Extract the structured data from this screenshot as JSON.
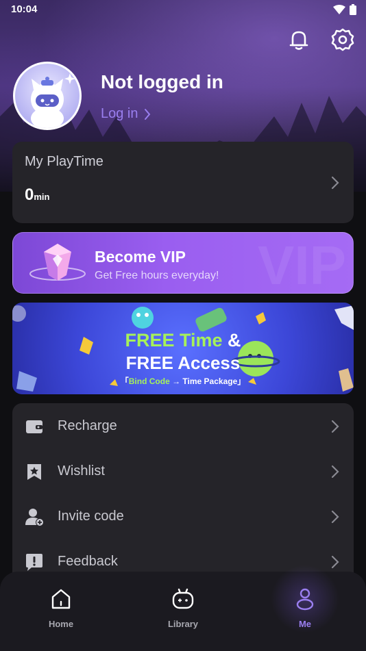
{
  "status": {
    "time": "10:04"
  },
  "profile": {
    "name": "Not logged in",
    "login_label": "Log in"
  },
  "playtime": {
    "label": "My PlayTime",
    "value": "0",
    "unit": "min"
  },
  "vip": {
    "title": "Become VIP",
    "subtitle": "Get Free hours everyday!",
    "watermark": "VIP"
  },
  "banner": {
    "line1_free": "FREE Time",
    "line1_amp": " &",
    "line2": "FREE Access",
    "line3_open": "「",
    "line3_code": "Bind Code",
    "line3_arrow": " → ",
    "line3_pkg": "Time Package",
    "line3_close": "」"
  },
  "menu": {
    "items": [
      {
        "label": "Recharge",
        "icon": "wallet-icon"
      },
      {
        "label": "Wishlist",
        "icon": "star-bookmark-icon"
      },
      {
        "label": "Invite code",
        "icon": "add-user-icon"
      },
      {
        "label": "Feedback",
        "icon": "feedback-icon"
      }
    ]
  },
  "nav": {
    "items": [
      {
        "label": "Home",
        "icon": "home-icon"
      },
      {
        "label": "Library",
        "icon": "gamepad-icon"
      },
      {
        "label": "Me",
        "icon": "profile-icon",
        "active": true
      }
    ]
  },
  "colors": {
    "accent": "#9a7ff0",
    "card": "#252429",
    "banner_green": "#a6f15a"
  }
}
